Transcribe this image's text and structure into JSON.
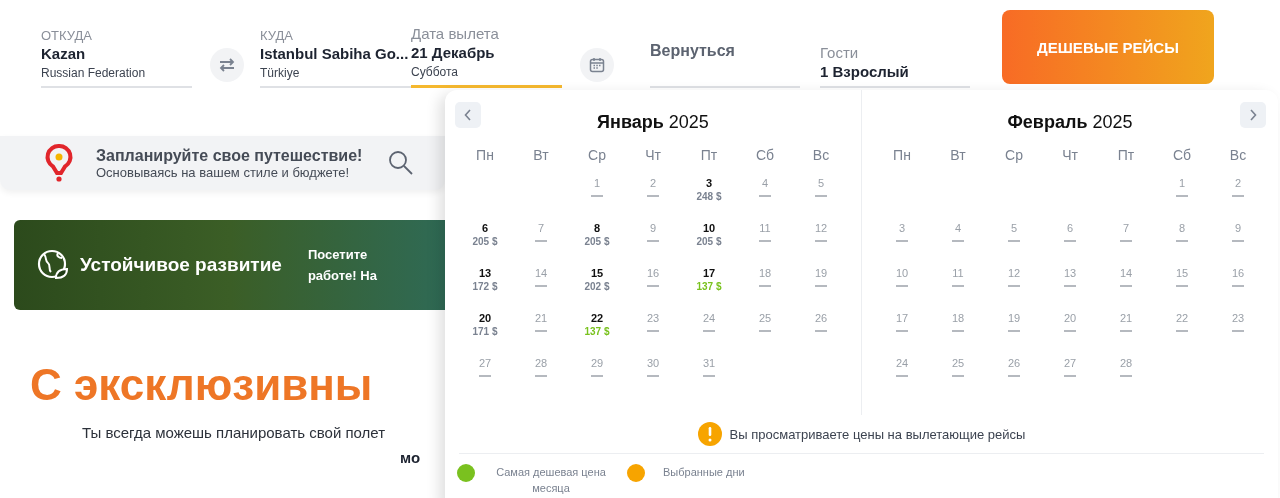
{
  "search_bar": {
    "fields": [
      {
        "kind": "place",
        "label": "ОТКУДА",
        "value": "Kazan",
        "sub": "Russian Federation",
        "active": false
      },
      {
        "kind": "place",
        "label": "КУДА",
        "value": "Istanbul Sabiha Go...",
        "sub": "Türkiye",
        "active": false
      },
      {
        "kind": "date",
        "label": "Дата вылета",
        "value": "21 Декабрь",
        "sub": "Суббота",
        "active": true
      },
      {
        "kind": "return",
        "placeholder": "Вернуться",
        "active": false
      },
      {
        "kind": "guests",
        "label": "Гости",
        "value": "1 Взрослый",
        "active": false
      }
    ],
    "search_button": "ДЕШЕВЫЕ РЕЙСЫ"
  },
  "plan_banner": {
    "title": "Запланируйте свое путешествие!",
    "subtitle": "Основываясь на вашем стиле и бюджете!"
  },
  "sustainability_banner": {
    "title": "Устойчивое развитие",
    "text_lines": [
      "Посетите",
      "работе! На"
    ]
  },
  "promo": {
    "heading": "С эксклюзивны",
    "text": "Ты всегда можешь планировать свой полет",
    "text_2": "мо"
  },
  "calendar": {
    "months": [
      {
        "title": "**Январь** 2025",
        "weekdays": [
          "Пн",
          "Вт",
          "Ср",
          "Чт",
          "Пт",
          "Сб",
          "Вс"
        ],
        "days": [
          {
            "kind": "blank"
          },
          {
            "kind": "blank"
          },
          {
            "kind": "none",
            "day": "1"
          },
          {
            "kind": "none",
            "day": "2"
          },
          {
            "kind": "priced",
            "day": "3",
            "price": "248 $"
          },
          {
            "kind": "none",
            "day": "4"
          },
          {
            "kind": "none",
            "day": "5"
          },
          {
            "kind": "priced",
            "day": "6",
            "price": "205 $"
          },
          {
            "kind": "none",
            "day": "7"
          },
          {
            "kind": "priced",
            "day": "8",
            "price": "205 $"
          },
          {
            "kind": "none",
            "day": "9"
          },
          {
            "kind": "priced",
            "day": "10",
            "price": "205 $"
          },
          {
            "kind": "none",
            "day": "11"
          },
          {
            "kind": "none",
            "day": "12"
          },
          {
            "kind": "priced",
            "day": "13",
            "price": "172 $"
          },
          {
            "kind": "none",
            "day": "14"
          },
          {
            "kind": "priced",
            "day": "15",
            "price": "202 $"
          },
          {
            "kind": "none",
            "day": "16"
          },
          {
            "kind": "cheapest",
            "day": "17",
            "price": "137 $"
          },
          {
            "kind": "none",
            "day": "18"
          },
          {
            "kind": "none",
            "day": "19"
          },
          {
            "kind": "priced",
            "day": "20",
            "price": "171 $"
          },
          {
            "kind": "none",
            "day": "21"
          },
          {
            "kind": "cheapest",
            "day": "22",
            "price": "137 $"
          },
          {
            "kind": "none",
            "day": "23"
          },
          {
            "kind": "none",
            "day": "24"
          },
          {
            "kind": "none",
            "day": "25"
          },
          {
            "kind": "none",
            "day": "26"
          },
          {
            "kind": "none",
            "day": "27"
          },
          {
            "kind": "none",
            "day": "28"
          },
          {
            "kind": "none",
            "day": "29"
          },
          {
            "kind": "none",
            "day": "30"
          },
          {
            "kind": "none",
            "day": "31"
          }
        ]
      },
      {
        "title": "**Февраль** 2025",
        "weekdays": [
          "Пн",
          "Вт",
          "Ср",
          "Чт",
          "Пт",
          "Сб",
          "Вс"
        ],
        "days": [
          {
            "kind": "blank"
          },
          {
            "kind": "blank"
          },
          {
            "kind": "blank"
          },
          {
            "kind": "blank"
          },
          {
            "kind": "blank"
          },
          {
            "kind": "none",
            "day": "1"
          },
          {
            "kind": "none",
            "day": "2"
          },
          {
            "kind": "none",
            "day": "3"
          },
          {
            "kind": "none",
            "day": "4"
          },
          {
            "kind": "none",
            "day": "5"
          },
          {
            "kind": "none",
            "day": "6"
          },
          {
            "kind": "none",
            "day": "7"
          },
          {
            "kind": "none",
            "day": "8"
          },
          {
            "kind": "none",
            "day": "9"
          },
          {
            "kind": "none",
            "day": "10"
          },
          {
            "kind": "none",
            "day": "11"
          },
          {
            "kind": "none",
            "day": "12"
          },
          {
            "kind": "none",
            "day": "13"
          },
          {
            "kind": "none",
            "day": "14"
          },
          {
            "kind": "none",
            "day": "15"
          },
          {
            "kind": "none",
            "day": "16"
          },
          {
            "kind": "none",
            "day": "17"
          },
          {
            "kind": "none",
            "day": "18"
          },
          {
            "kind": "none",
            "day": "19"
          },
          {
            "kind": "none",
            "day": "20"
          },
          {
            "kind": "none",
            "day": "21"
          },
          {
            "kind": "none",
            "day": "22"
          },
          {
            "kind": "none",
            "day": "23"
          },
          {
            "kind": "none",
            "day": "24"
          },
          {
            "kind": "none",
            "day": "25"
          },
          {
            "kind": "none",
            "day": "26"
          },
          {
            "kind": "none",
            "day": "27"
          },
          {
            "kind": "none",
            "day": "28"
          }
        ]
      }
    ],
    "notice": "Вы просматриваете цены на вылетающие рейсы",
    "legend": [
      {
        "label": "Самая дешевая цена месяца",
        "color": "#7ac11f"
      },
      {
        "label": "Выбранные дни",
        "color": "#f7a400"
      }
    ]
  }
}
